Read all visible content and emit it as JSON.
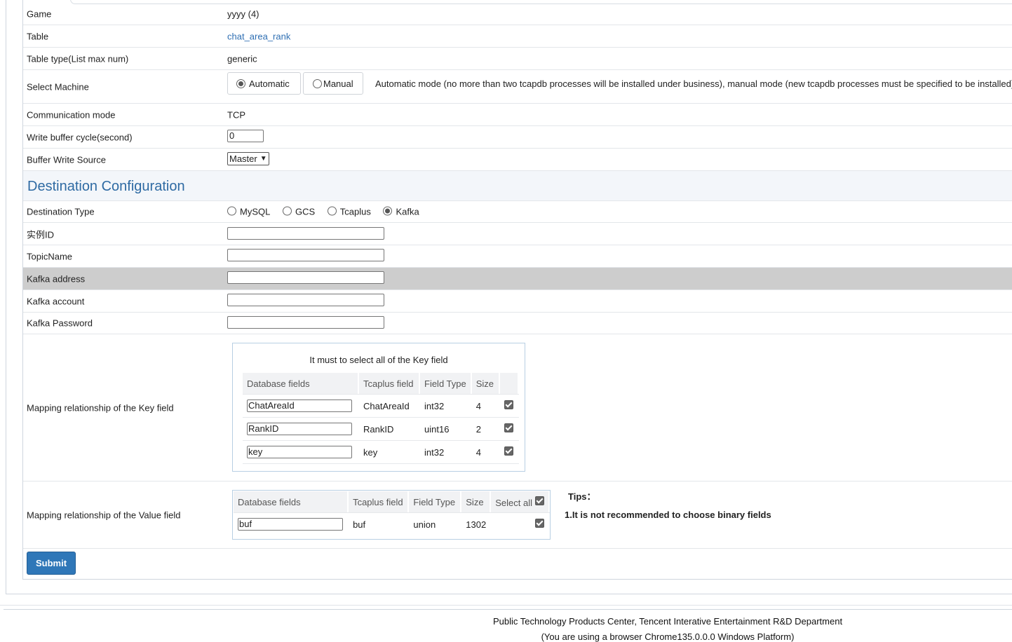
{
  "basic": {
    "game_label": "Game",
    "game_value": "yyyy (4)",
    "table_label": "Table",
    "table_value": "chat_area_rank",
    "table_type_label": "Table type(List max num)",
    "table_type_value": "generic",
    "select_machine_label": "Select Machine",
    "machine_options": [
      "Automatic",
      "Manual"
    ],
    "machine_selected": "Automatic",
    "machine_hint": "Automatic mode (no more than two tcapdb processes will be installed under business), manual mode (new tcapdb processes must be specified to be installed)",
    "comm_mode_label": "Communication mode",
    "comm_mode_value": "TCP",
    "write_buffer_label": "Write buffer cycle(second)",
    "write_buffer_value": "0",
    "buffer_source_label": "Buffer Write Source",
    "buffer_source_value": "Master"
  },
  "destination": {
    "section_title": "Destination Configuration",
    "type_label": "Destination Type",
    "type_options": [
      "MySQL",
      "GCS",
      "Tcaplus",
      "Kafka"
    ],
    "type_selected": "Kafka",
    "instance_id_label": "实例ID",
    "topic_label": "TopicName",
    "kafka_address_label": "Kafka address",
    "kafka_account_label": "Kafka account",
    "kafka_password_label": "Kafka Password"
  },
  "key_mapping": {
    "label": "Mapping relationship of the Key field",
    "caption": "It must to select all of the Key field",
    "headers": [
      "Database fields",
      "Tcaplus field",
      "Field Type",
      "Size",
      ""
    ],
    "rows": [
      {
        "db": "ChatAreaId",
        "tcaplus": "ChatAreaId",
        "type": "int32",
        "size": "4",
        "checked": true
      },
      {
        "db": "RankID",
        "tcaplus": "RankID",
        "type": "uint16",
        "size": "2",
        "checked": true
      },
      {
        "db": "key",
        "tcaplus": "key",
        "type": "int32",
        "size": "4",
        "checked": true
      }
    ]
  },
  "value_mapping": {
    "label": "Mapping relationship of the Value field",
    "headers": [
      "Database fields",
      "Tcaplus field",
      "Field Type",
      "Size",
      "Select all"
    ],
    "select_all_checked": true,
    "rows": [
      {
        "db": "buf",
        "tcaplus": "buf",
        "type": "union",
        "size": "1302",
        "checked": true
      }
    ],
    "tips_title": "Tips：",
    "tips_line1": "1.It is not recommended to choose binary fields"
  },
  "submit_label": "Submit",
  "footer": {
    "line1": "Public Technology Products Center, Tencent Interative Entertainment R&D Department",
    "line2": "(You are using a browser Chrome135.0.0.0 Windows Platform)"
  }
}
